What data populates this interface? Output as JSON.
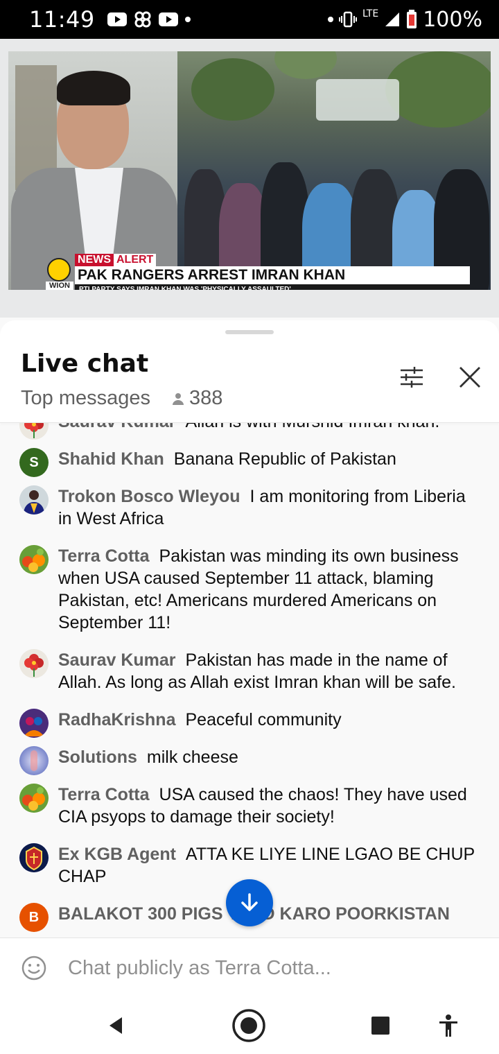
{
  "status_bar": {
    "time": "11:49",
    "battery": "100%",
    "network": "LTE"
  },
  "video": {
    "news_label": "NEWS",
    "alert_label": "ALERT",
    "headline": "PAK RANGERS ARREST IMRAN KHAN",
    "subheadline": "PTI PARTY SAYS IMRAN KHAN WAS 'PHYSICALLY ASSAULTED'",
    "channel_logo": "WION"
  },
  "chat": {
    "title": "Live chat",
    "mode": "Top messages",
    "viewer_count": "388",
    "messages": [
      {
        "author": "Saurav Kumar",
        "text": "Allah is with Murshid Imran khan.",
        "avatar": "flower-avatar"
      },
      {
        "author": "Shahid Khan",
        "text": "Banana Republic of Pakistan",
        "avatar_letter": "S",
        "avatar_color": "#33691e"
      },
      {
        "author": "Trokon Bosco Wleyou",
        "text": "I am monitoring from Liberia in West Africa",
        "avatar": "person-avatar"
      },
      {
        "author": "Terra Cotta",
        "text": "Pakistan was minding its own business when USA caused September 11 attack, blaming Pakistan, etc! Americans murdered Americans on September 11!",
        "avatar": "pots-avatar"
      },
      {
        "author": "Saurav Kumar",
        "text": "Pakistan has made in the name of Allah. As long as Allah exist Imran khan will be safe.",
        "avatar": "flower-avatar"
      },
      {
        "author": "RadhaKrishna",
        "text": "Peaceful community",
        "avatar": "deity-avatar"
      },
      {
        "author": "Solutions",
        "text": "milk cheese",
        "avatar": "abstract-avatar"
      },
      {
        "author": "Terra Cotta",
        "text": "USA caused the chaos! They have used CIA psyops to damage their society!",
        "avatar": "pots-avatar"
      },
      {
        "author": "Ex KGB Agent",
        "text": "ATTA KE LIYE LINE LGAO BE CHUP CHAP",
        "avatar": "emblem-avatar"
      },
      {
        "author": "BALAKOT 300 PIGS YAAD KARO POORKISTAN",
        "text": "",
        "avatar_letter": "B",
        "avatar_color": "#e65100"
      }
    ],
    "input_placeholder": "Chat publicly as Terra Cotta..."
  },
  "colors": {
    "accent": "#065fd4",
    "news_red": "#c8102e",
    "wion_yellow": "#ffd100"
  }
}
